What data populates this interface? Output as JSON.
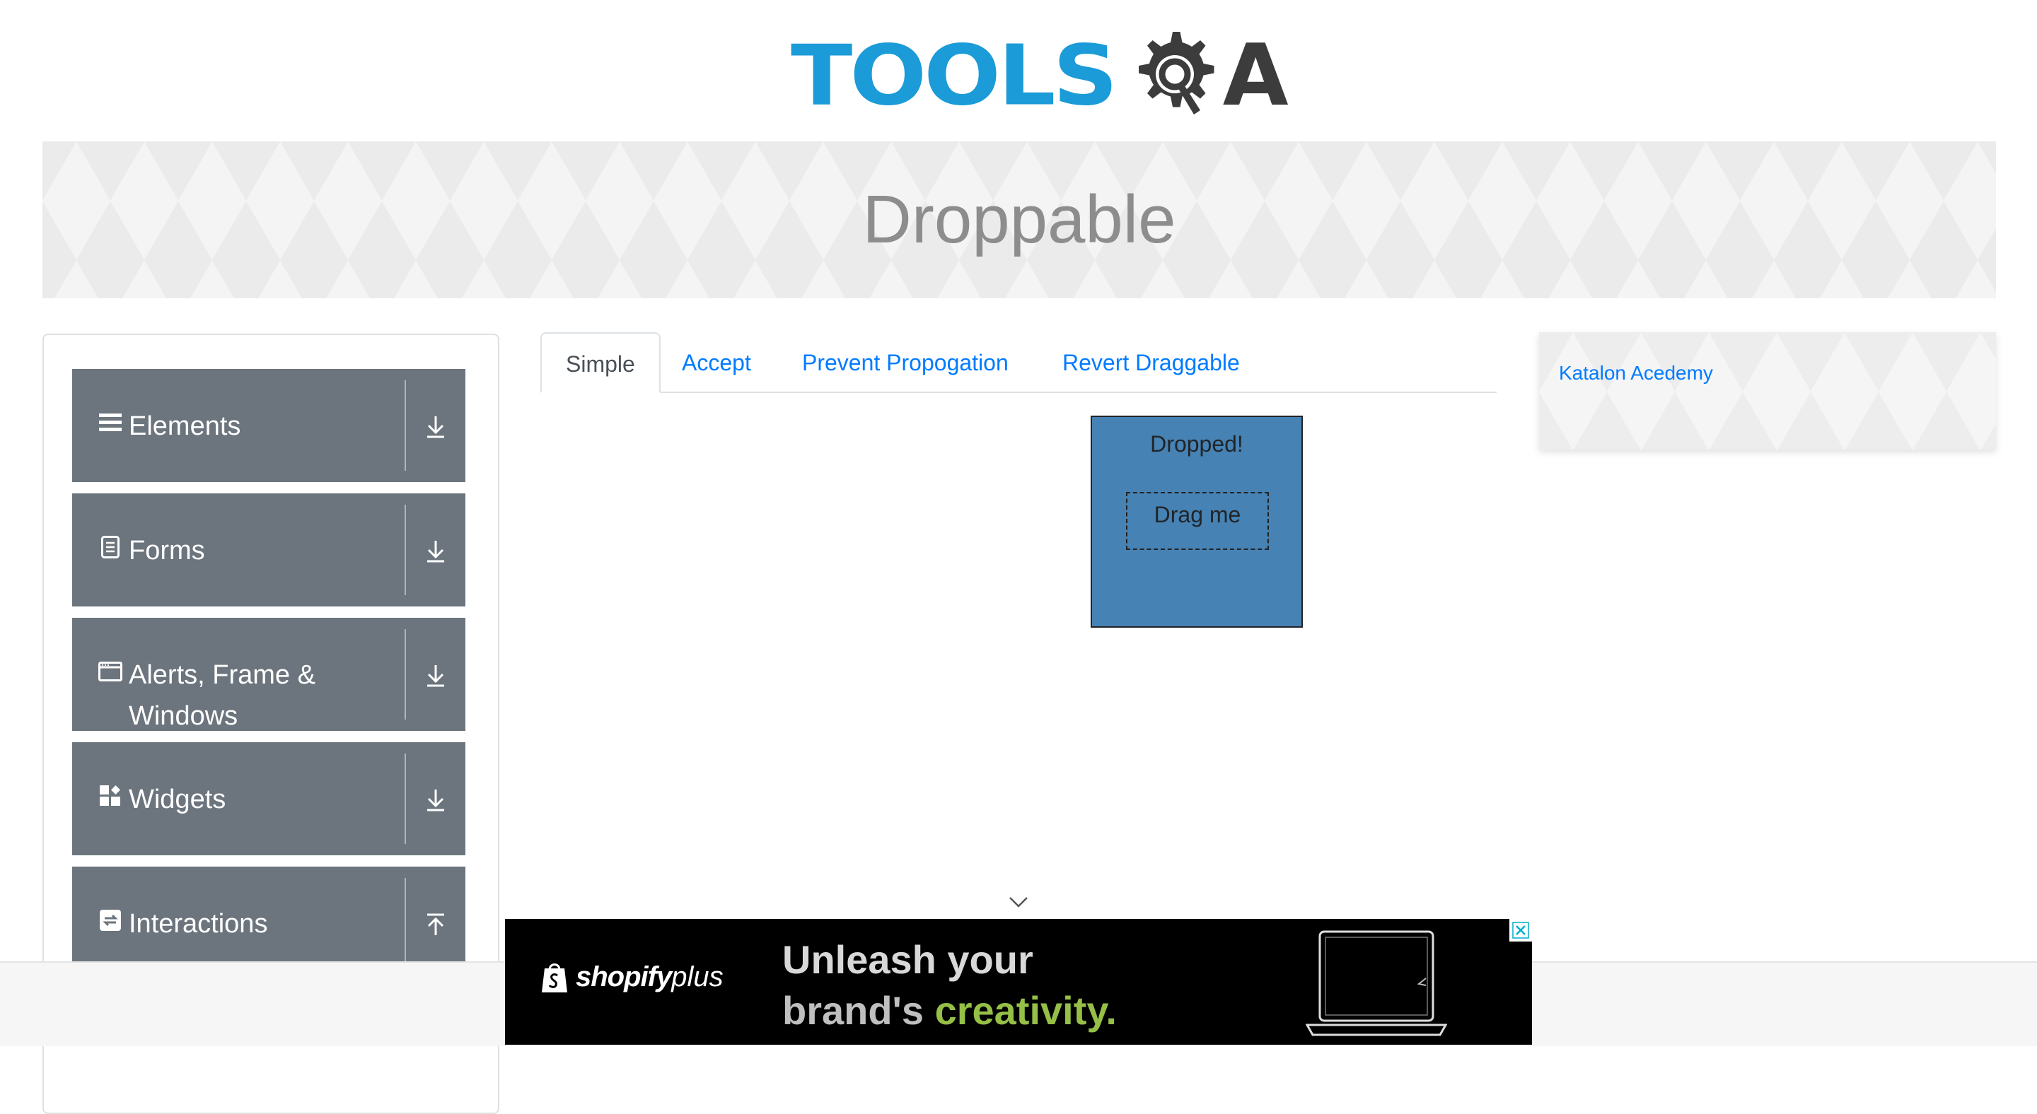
{
  "header": {
    "logo_text_tools": "TOOLS",
    "logo_text_a": "A"
  },
  "banner": {
    "title": "Droppable"
  },
  "sidebar": {
    "groups": [
      {
        "label": "Elements",
        "icon": "list-icon",
        "toggle": "download-icon"
      },
      {
        "label": "Forms",
        "icon": "form-icon",
        "toggle": "download-icon"
      },
      {
        "label": "Alerts, Frame & Windows",
        "icon": "window-icon",
        "toggle": "download-icon"
      },
      {
        "label": "Widgets",
        "icon": "widgets-icon",
        "toggle": "download-icon"
      },
      {
        "label": "Interactions",
        "icon": "interactions-icon",
        "toggle": "upload-icon"
      }
    ]
  },
  "tabs": [
    {
      "label": "Simple",
      "active": true
    },
    {
      "label": "Accept",
      "active": false
    },
    {
      "label": "Prevent Propogation",
      "active": false
    },
    {
      "label": "Revert Draggable",
      "active": false
    }
  ],
  "simple": {
    "drop_label": "Dropped!",
    "drag_label": "Drag me",
    "drop_color": "#4682b4"
  },
  "right_sidebar": {
    "link": "Katalon Acedemy"
  },
  "ad": {
    "brand": "shopify",
    "brand_suffix": "plus",
    "headline_line1": "Unleash your",
    "headline_line2a": "brand's ",
    "headline_line2b": "creativity.",
    "accent": "#95bf47"
  },
  "colors": {
    "primary_link": "#007bff",
    "menu_bg": "#6c757d",
    "logo_blue": "#1b9bd7"
  }
}
